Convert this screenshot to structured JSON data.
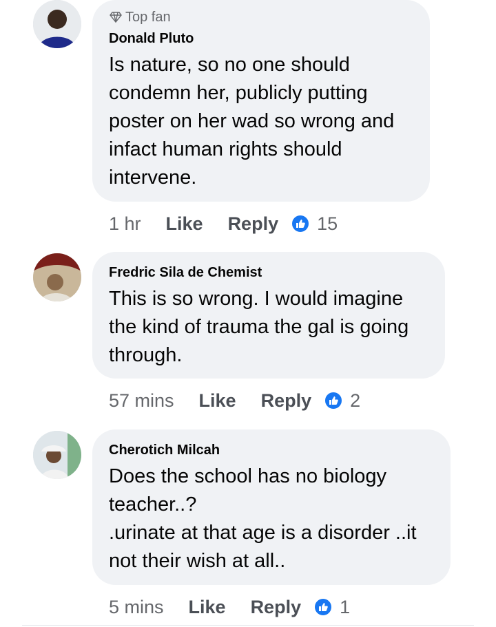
{
  "comments": [
    {
      "badge": "Top fan",
      "author": "Donald Pluto",
      "text": "Is nature, so no one should\ncondemn her, publicly putting\nposter on her wad so wrong and\ninfact human rights should\nintervene.",
      "time": "1 hr",
      "like_label": "Like",
      "reply_label": "Reply",
      "reactions": "15"
    },
    {
      "author": "Fredric Sila de Chemist",
      "text": "This is so wrong. I would imagine\nthe kind of trauma the gal is going\nthrough.",
      "time": "57 mins",
      "like_label": "Like",
      "reply_label": "Reply",
      "reactions": "2"
    },
    {
      "author": "Cherotich Milcah",
      "text": "Does the school has no biology\nteacher..?\n.urinate at that age is a disorder ..it\nnot their wish at all..",
      "time": "5 mins",
      "like_label": "Like",
      "reply_label": "Reply",
      "reactions": "1"
    }
  ],
  "icons": {
    "badge": "diamond-icon",
    "reaction": "thumbs-up-icon"
  },
  "colors": {
    "bubble": "#f0f2f5",
    "like_blue": "#1877f2",
    "muted": "#65676b"
  }
}
